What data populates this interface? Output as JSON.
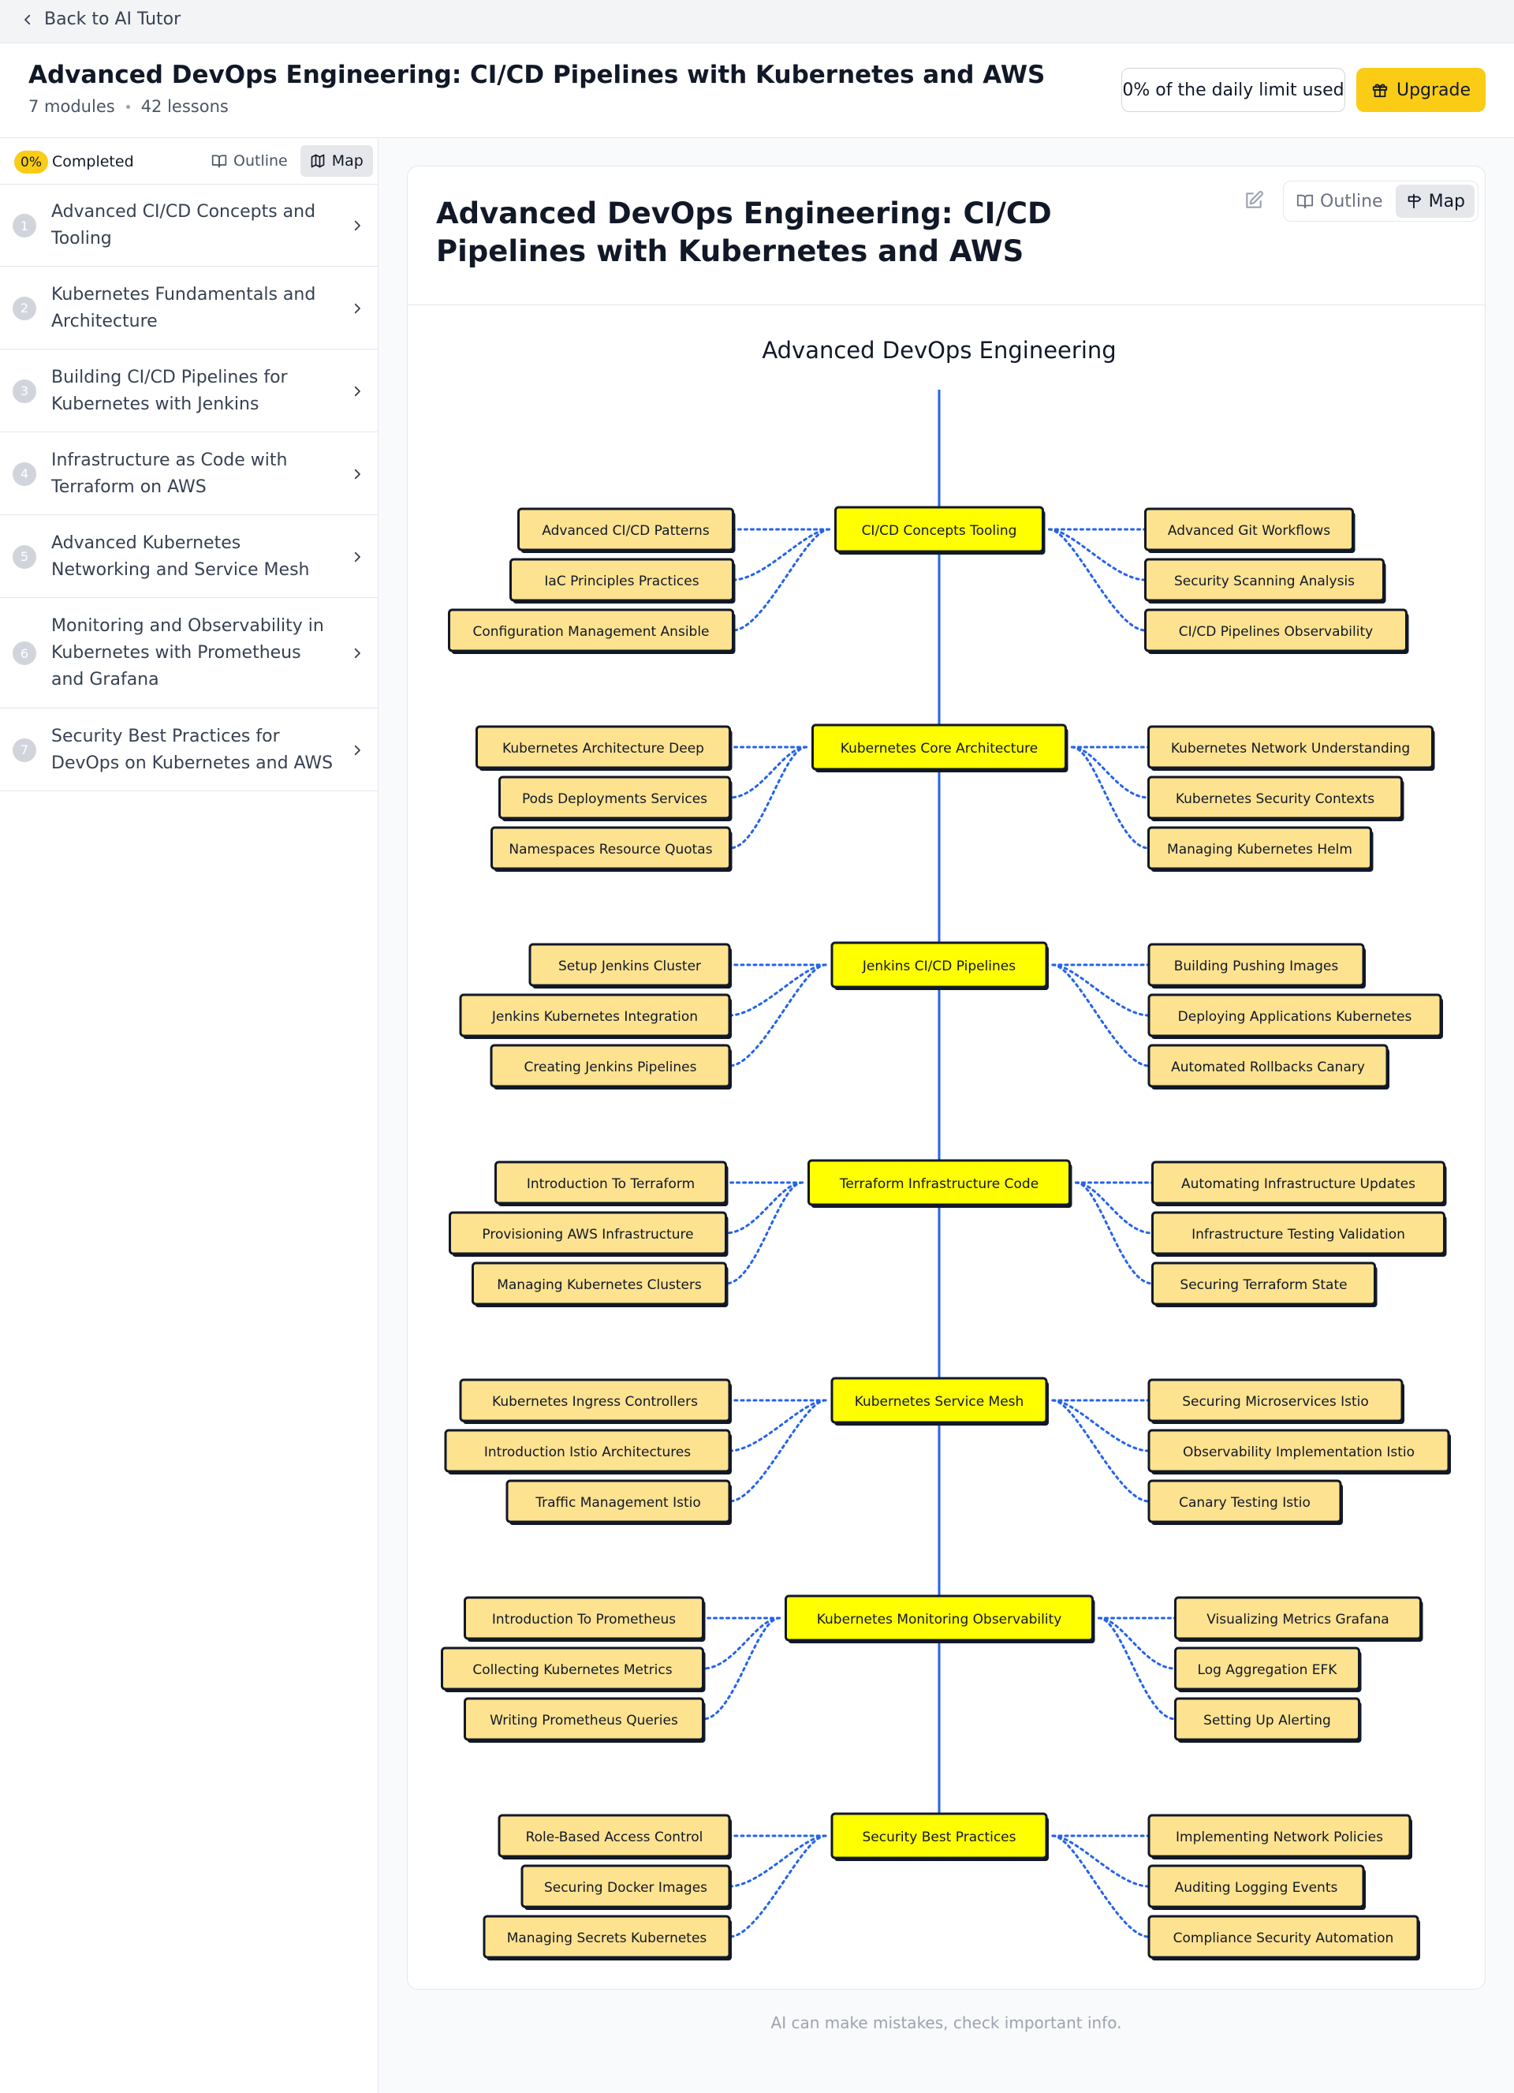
{
  "nav": {
    "back_label": "Back  to AI Tutor"
  },
  "course": {
    "title": "Advanced DevOps Engineering: CI/CD Pipelines with Kubernetes and AWS",
    "modules_count": "7 modules",
    "lessons_count": "42 lessons"
  },
  "header": {
    "limit_text": "0% of the daily limit used",
    "upgrade_label": "Upgrade"
  },
  "sidebar": {
    "progress_badge": "0%",
    "completed_label": "Completed",
    "outline_label": "Outline",
    "map_label": "Map",
    "modules": [
      {
        "num": "1",
        "label": "Advanced CI/CD Concepts and Tooling"
      },
      {
        "num": "2",
        "label": "Kubernetes Fundamentals and Architecture"
      },
      {
        "num": "3",
        "label": "Building CI/CD Pipelines for Kubernetes with Jenkins"
      },
      {
        "num": "4",
        "label": "Infrastructure as Code with Terraform on AWS"
      },
      {
        "num": "5",
        "label": "Advanced Kubernetes Networking and Service Mesh"
      },
      {
        "num": "6",
        "label": "Monitoring and Observability in Kubernetes with Prometheus and Grafana"
      },
      {
        "num": "7",
        "label": "Security Best Practices for DevOps on Kubernetes and AWS"
      }
    ]
  },
  "card": {
    "title": "Advanced DevOps Engineering: CI/CD Pipelines with Kubernetes and AWS",
    "outline_label": "Outline",
    "map_label": "Map"
  },
  "mindmap": {
    "root": "Advanced DevOps Engineering",
    "colors": {
      "spine": "#2563eb",
      "module_fill": "#ffff00",
      "lesson_fill": "#fde290",
      "connector": "#2563eb"
    },
    "modules": [
      {
        "label": "CI/CD Concepts Tooling",
        "left": [
          "Advanced CI/CD Patterns",
          "IaC Principles Practices",
          "Configuration Management Ansible"
        ],
        "right": [
          "Advanced Git Workflows",
          "Security Scanning Analysis",
          "CI/CD Pipelines Observability"
        ]
      },
      {
        "label": "Kubernetes Core Architecture",
        "left": [
          "Kubernetes Architecture Deep",
          "Pods Deployments Services",
          "Namespaces Resource Quotas"
        ],
        "right": [
          "Kubernetes Network Understanding",
          "Kubernetes Security Contexts",
          "Managing Kubernetes Helm"
        ]
      },
      {
        "label": "Jenkins CI/CD Pipelines",
        "left": [
          "Setup Jenkins Cluster",
          "Jenkins Kubernetes Integration",
          "Creating Jenkins Pipelines"
        ],
        "right": [
          "Building Pushing Images",
          "Deploying Applications Kubernetes",
          "Automated Rollbacks Canary"
        ]
      },
      {
        "label": "Terraform Infrastructure Code",
        "left": [
          "Introduction To Terraform",
          "Provisioning AWS Infrastructure",
          "Managing Kubernetes Clusters"
        ],
        "right": [
          "Automating Infrastructure Updates",
          "Infrastructure Testing Validation",
          "Securing Terraform State"
        ]
      },
      {
        "label": "Kubernetes Service Mesh",
        "left": [
          "Kubernetes Ingress Controllers",
          "Introduction Istio Architectures",
          "Traffic Management Istio"
        ],
        "right": [
          "Securing Microservices Istio",
          "Observability Implementation Istio",
          "Canary Testing Istio"
        ]
      },
      {
        "label": "Kubernetes Monitoring Observability",
        "left": [
          "Introduction To Prometheus",
          "Collecting Kubernetes Metrics",
          "Writing Prometheus Queries"
        ],
        "right": [
          "Visualizing Metrics Grafana",
          "Log Aggregation EFK",
          "Setting Up Alerting"
        ]
      },
      {
        "label": "Security Best Practices",
        "left": [
          "Role-Based Access Control",
          "Securing Docker Images",
          "Managing Secrets Kubernetes"
        ],
        "right": [
          "Implementing Network Policies",
          "Auditing Logging Events",
          "Compliance Security Automation"
        ]
      }
    ]
  },
  "footer": {
    "note": "AI can make mistakes, check important info."
  }
}
